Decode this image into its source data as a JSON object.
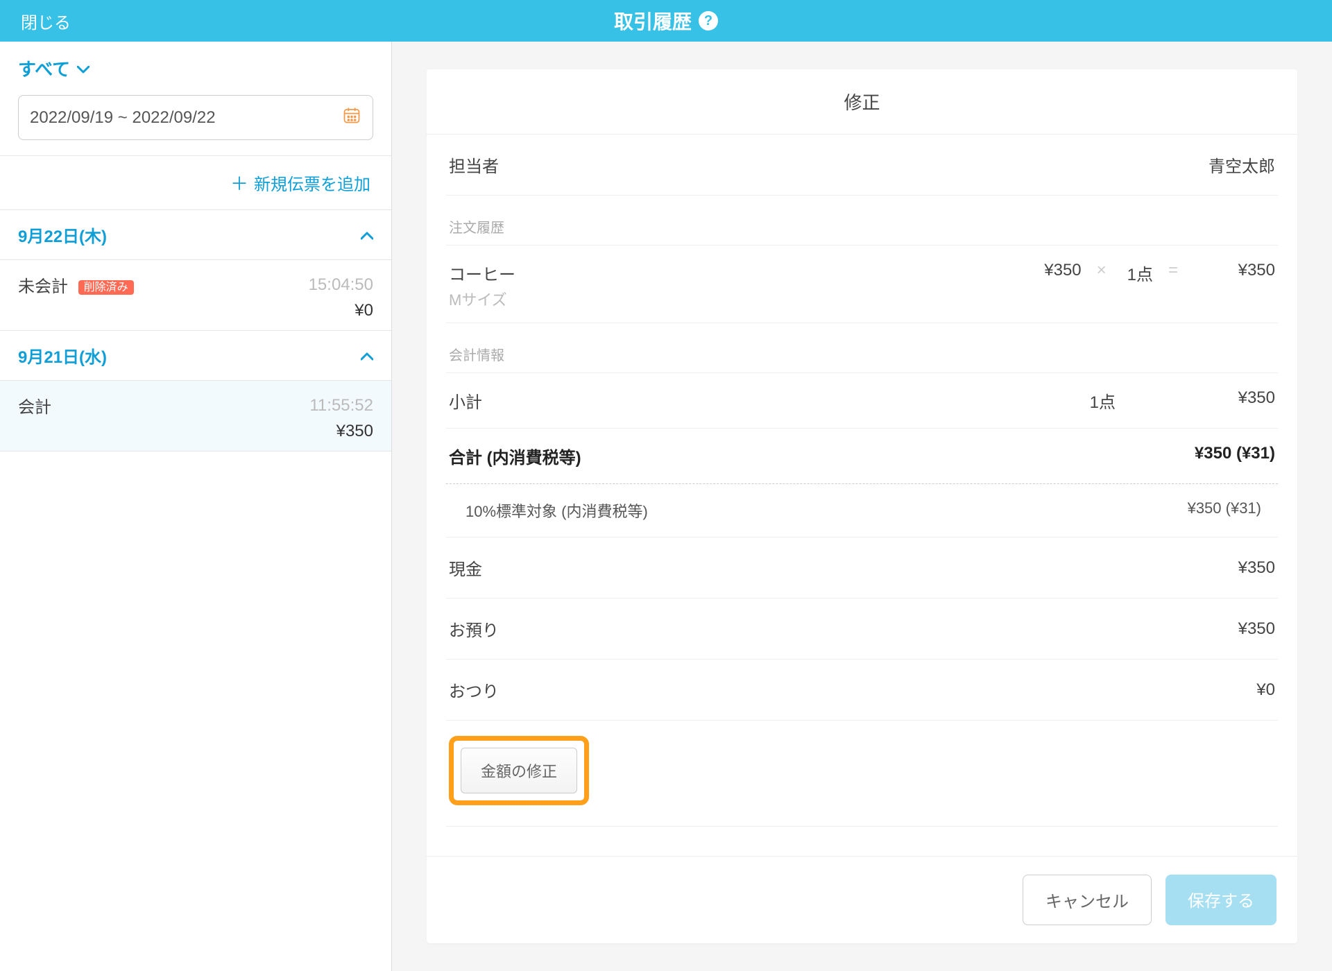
{
  "header": {
    "close": "閉じる",
    "title": "取引履歴"
  },
  "sidebar": {
    "filter_label": "すべて",
    "date_range": "2022/09/19 ~ 2022/09/22",
    "add_label": "新規伝票を追加",
    "groups": [
      {
        "date_label": "9月22日(木)",
        "rows": [
          {
            "status": "未会計",
            "deleted_badge": "削除済み",
            "time": "15:04:50",
            "amount": "¥0"
          }
        ]
      },
      {
        "date_label": "9月21日(水)",
        "rows": [
          {
            "status": "会計",
            "time": "11:55:52",
            "amount": "¥350",
            "selected": true
          }
        ]
      }
    ]
  },
  "detail": {
    "head": "修正",
    "staff_label": "担当者",
    "staff_value": "青空太郎",
    "order_section": "注文履歴",
    "order": {
      "name": "コーヒー",
      "sub": "Mサイズ",
      "unit_price": "¥350",
      "qty": "1点",
      "line_total": "¥350",
      "sym_mul": "×",
      "sym_eq": "="
    },
    "acct_section": "会計情報",
    "subtotal_label": "小計",
    "subtotal_qty": "1点",
    "subtotal_amount": "¥350",
    "total_label": "合計 (内消費税等)",
    "total_value": "¥350 (¥31)",
    "tax_line_label": "10%標準対象 (内消費税等)",
    "tax_line_value": "¥350 (¥31)",
    "cash_label": "現金",
    "cash_value": "¥350",
    "deposit_label": "お預り",
    "deposit_value": "¥350",
    "change_label": "おつり",
    "change_value": "¥0",
    "amount_edit": "金額の修正",
    "cancel": "キャンセル",
    "save": "保存する"
  }
}
